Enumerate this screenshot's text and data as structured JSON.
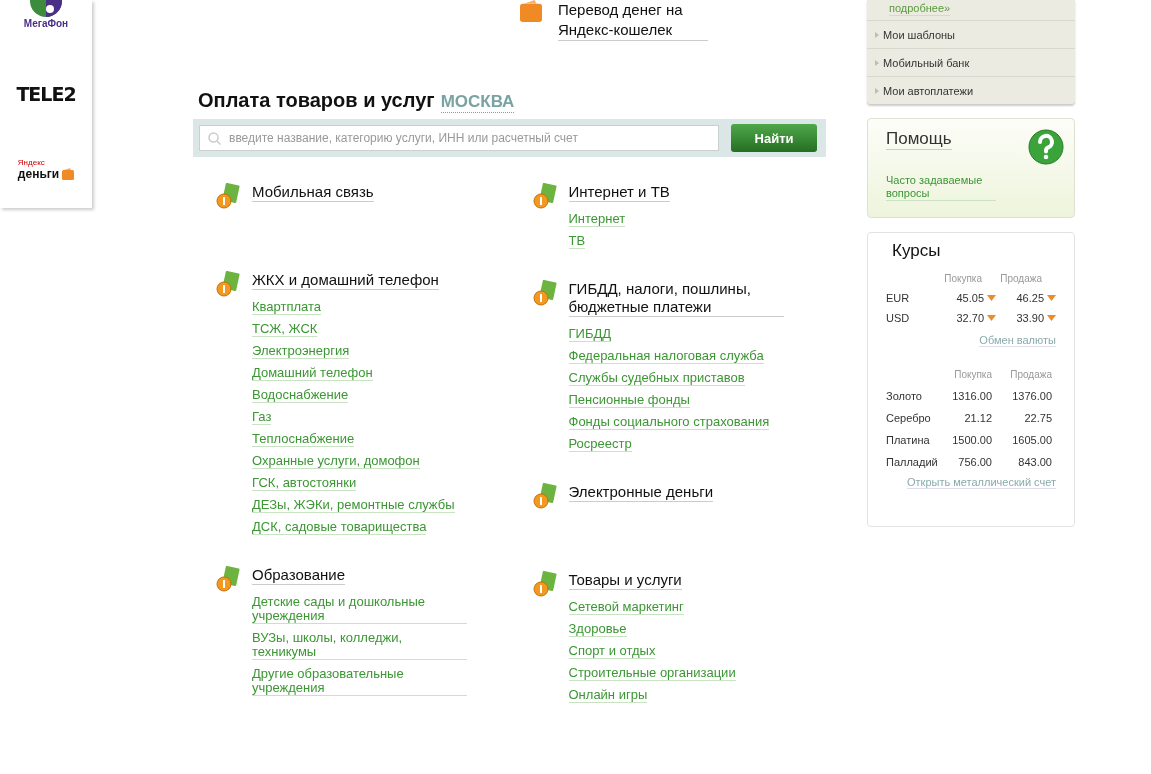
{
  "operators": [
    {
      "kind": "megafon",
      "name": "МегаФон"
    },
    {
      "kind": "tele2",
      "name": "TELE2"
    },
    {
      "kind": "yandex",
      "brand": "Яндекс",
      "name": "деньги"
    }
  ],
  "transfer": {
    "label": "Перевод денег на Яндекс-кошелек"
  },
  "payments": {
    "title": "Оплата товаров и услуг",
    "region": "МОСКВА",
    "search": {
      "placeholder": "введите название, категорию услуги, ИНН или расчетный счет",
      "button": "Найти"
    },
    "columns": [
      [
        {
          "title": "Мобильная связь"
        },
        {
          "title": "ЖКХ и домашний телефон",
          "items": [
            "Квартплата",
            "ТСЖ, ЖСК",
            "Электроэнергия",
            "Домашний телефон",
            "Водоснабжение",
            "Газ",
            "Теплоснабжение",
            "Охранные услуги, домофон",
            "ГСК, автостоянки",
            "ДЕЗы, ЖЭКи, ремонтные службы",
            "ДСК, садовые товарищества"
          ]
        },
        {
          "title": "Образование",
          "items": [
            "Детские сады и дошкольные учреждения",
            "ВУЗы, школы, колледжи, техникумы",
            "Другие образовательные учреждения"
          ]
        }
      ],
      [
        {
          "title": "Интернет и ТВ",
          "items": [
            "Интернет",
            "ТВ"
          ]
        },
        {
          "title": "ГИБДД, налоги, пошлины, бюджетные платежи",
          "items": [
            "ГИБДД",
            "Федеральная налоговая служба",
            "Службы судебных приставов",
            "Пенсионные фонды",
            "Фонды социального страхования",
            "Росреестр"
          ]
        },
        {
          "title": "Электронные деньги"
        },
        {
          "title": "Товары и услуги",
          "items": [
            "Сетевой маркетинг",
            "Здоровье",
            "Спорт и отдых",
            "Строительные организации",
            "Онлайн игры"
          ]
        }
      ]
    ]
  },
  "menu": {
    "more": "подробнее»",
    "items": [
      "Мои шаблоны",
      "Мобильный банк",
      "Мои автоплатежи"
    ]
  },
  "help": {
    "title": "Помощь",
    "link": "Часто задаваемые вопросы"
  },
  "rates": {
    "title": "Курсы",
    "currency_columns": [
      "Покупка",
      "Продажа"
    ],
    "currencies": [
      {
        "name": "EUR",
        "buy": "45.05",
        "buy_falling": true,
        "sell": "46.25",
        "sell_falling": true
      },
      {
        "name": "USD",
        "buy": "32.70",
        "buy_falling": true,
        "sell": "33.90",
        "sell_falling": true
      }
    ],
    "exchange_link": "Обмен валюты",
    "metal_columns": [
      "Покупка",
      "Продажа"
    ],
    "metals": [
      {
        "name": "Золото",
        "buy": "1316.00",
        "sell": "1376.00"
      },
      {
        "name": "Серебро",
        "buy": "21.12",
        "sell": "22.75"
      },
      {
        "name": "Платина",
        "buy": "1500.00",
        "sell": "1605.00"
      },
      {
        "name": "Палладий",
        "buy": "756.00",
        "sell": "843.00"
      }
    ],
    "metal_link": "Открыть металлический счет"
  }
}
